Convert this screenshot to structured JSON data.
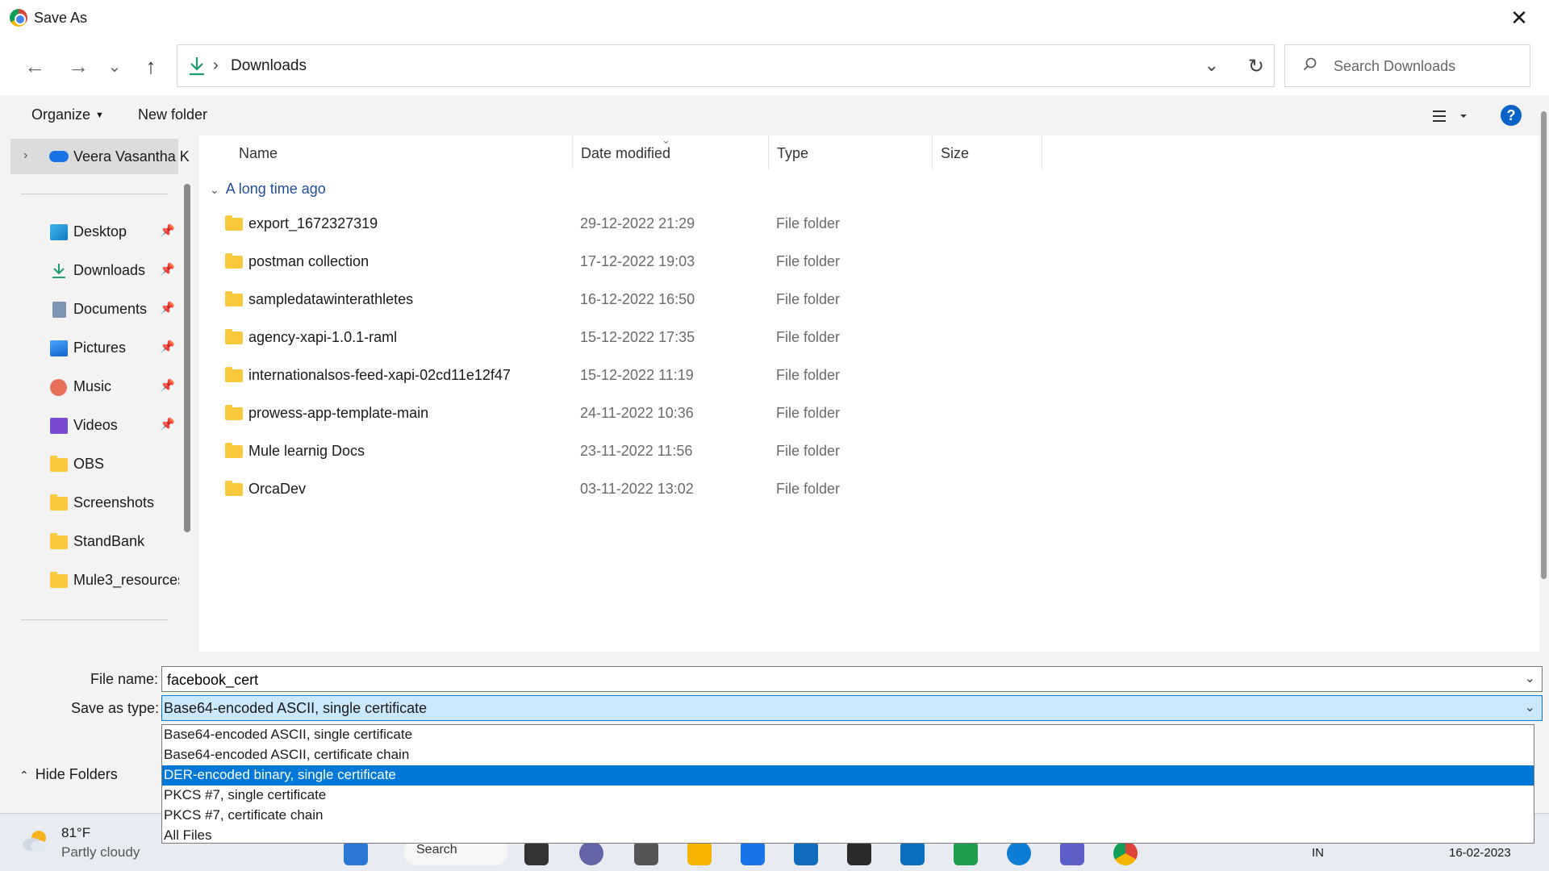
{
  "window": {
    "title": "Save As",
    "close_glyph": "✕"
  },
  "address": {
    "crumb": "Downloads",
    "search_placeholder": "Search Downloads"
  },
  "nav_buttons": {
    "back": "←",
    "forward": "→",
    "recent": "⌄",
    "up": "↑"
  },
  "commandbar": {
    "organize": "Organize",
    "new_folder": "New folder",
    "help": "?"
  },
  "navpane": {
    "onedrive": "Veera Vasantha K",
    "items": [
      {
        "label": "Desktop",
        "icon": "desktop-icon",
        "pinned": true
      },
      {
        "label": "Downloads",
        "icon": "downloads-icon",
        "pinned": true
      },
      {
        "label": "Documents",
        "icon": "documents-icon",
        "pinned": true
      },
      {
        "label": "Pictures",
        "icon": "pictures-icon",
        "pinned": true
      },
      {
        "label": "Music",
        "icon": "music-icon",
        "pinned": true
      },
      {
        "label": "Videos",
        "icon": "videos-icon",
        "pinned": true
      },
      {
        "label": "OBS",
        "icon": "folder-icon",
        "pinned": false
      },
      {
        "label": "Screenshots",
        "icon": "folder-icon",
        "pinned": false
      },
      {
        "label": "StandBank",
        "icon": "folder-icon",
        "pinned": false
      },
      {
        "label": "Mule3_resources",
        "icon": "folder-icon",
        "pinned": false
      }
    ]
  },
  "filelist": {
    "columns": [
      "Name",
      "Date modified",
      "Type",
      "Size"
    ],
    "group": "A long time ago",
    "rows": [
      {
        "name": "export_1672327319",
        "date": "29-12-2022 21:29",
        "type": "File folder"
      },
      {
        "name": "postman collection",
        "date": "17-12-2022 19:03",
        "type": "File folder"
      },
      {
        "name": "sampledatawinterathletes",
        "date": "16-12-2022 16:50",
        "type": "File folder"
      },
      {
        "name": "agency-xapi-1.0.1-raml",
        "date": "15-12-2022 17:35",
        "type": "File folder"
      },
      {
        "name": "internationalsos-feed-xapi-02cd11e12f47",
        "date": "15-12-2022 11:19",
        "type": "File folder"
      },
      {
        "name": "prowess-app-template-main",
        "date": "24-11-2022 10:36",
        "type": "File folder"
      },
      {
        "name": "Mule learnig Docs",
        "date": "23-11-2022 11:56",
        "type": "File folder"
      },
      {
        "name": "OrcaDev",
        "date": "03-11-2022 13:02",
        "type": "File folder"
      }
    ]
  },
  "form": {
    "file_name_label": "File name:",
    "file_name_value": "facebook_cert",
    "save_type_label": "Save as type:",
    "save_type_value": "Base64-encoded ASCII, single certificate",
    "hide_folders": "Hide Folders",
    "type_options": [
      "Base64-encoded ASCII, single certificate",
      "Base64-encoded ASCII, certificate chain",
      "DER-encoded binary, single certificate",
      "PKCS #7, single certificate",
      "PKCS #7, certificate chain",
      "All Files"
    ],
    "highlighted_option": "DER-encoded binary, single certificate"
  },
  "taskbar": {
    "weather_temp": "81°F",
    "weather_desc": "Partly cloudy",
    "search": "Search",
    "lang": "IN",
    "date": "16-02-2023"
  },
  "colors": {
    "accent": "#0078d7",
    "selected_bg": "#cce8ff",
    "folder": "#f8c93d"
  }
}
